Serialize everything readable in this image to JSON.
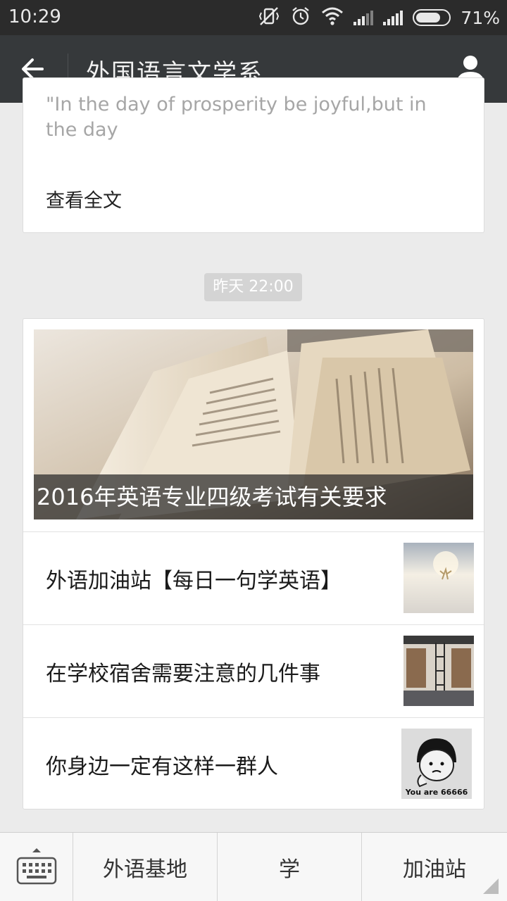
{
  "status_bar": {
    "time": "10:29",
    "battery_percent": "71%",
    "icons": [
      "vibrate-off-icon",
      "alarm-icon",
      "wifi-icon",
      "signal-icon",
      "signal-icon",
      "battery-icon"
    ]
  },
  "header": {
    "title": "外国语言文学系",
    "back_icon": "back-arrow-icon",
    "profile_icon": "profile-icon"
  },
  "messages": [
    {
      "excerpt": "\"In the day of prosperity be joyful,but in the day",
      "read_more": "查看全文"
    },
    {
      "timestamp": "昨天 22:00",
      "cover_title": "2016年英语专业四级考试有关要求",
      "items": [
        {
          "title": "外语加油站【每日一句学英语】"
        },
        {
          "title": "在学校宿舍需要注意的几件事"
        },
        {
          "title": "你身边一定有这样一群人",
          "thumb_text": "You are 66666"
        }
      ]
    }
  ],
  "bottom_menu": {
    "keyboard_icon": "keyboard-icon",
    "tabs": [
      "外语基地",
      "学",
      "加油站"
    ]
  },
  "colors": {
    "status_bar_bg": "#2b2b2b",
    "title_bar_bg": "#36393b",
    "page_bg": "#ebebeb"
  }
}
